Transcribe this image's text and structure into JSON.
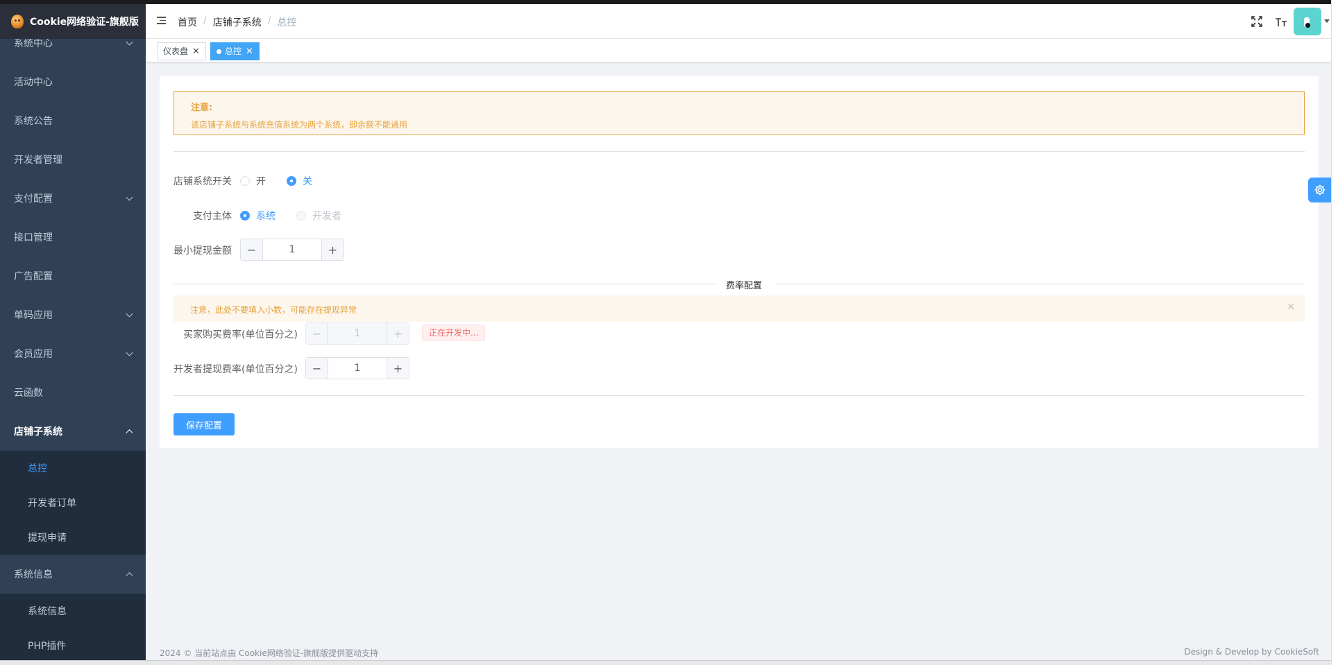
{
  "app": {
    "title": "Cookie网络验证-旗舰版"
  },
  "sidebar": {
    "items": [
      {
        "label": "系统中心",
        "has_children": true
      },
      {
        "label": "活动中心",
        "has_children": false
      },
      {
        "label": "系统公告",
        "has_children": false
      },
      {
        "label": "开发者管理",
        "has_children": false
      },
      {
        "label": "支付配置",
        "has_children": true
      },
      {
        "label": "接口管理",
        "has_children": false
      },
      {
        "label": "广告配置",
        "has_children": false
      },
      {
        "label": "单码应用",
        "has_children": true
      },
      {
        "label": "会员应用",
        "has_children": true
      },
      {
        "label": "云函数",
        "has_children": false
      },
      {
        "label": "店铺子系统",
        "has_children": true,
        "expanded": true
      },
      {
        "label": "系统信息",
        "has_children": true,
        "expanded": true
      }
    ],
    "shop_children": [
      "总控",
      "开发者订单",
      "提现申请"
    ],
    "info_children": [
      "系统信息",
      "PHP插件"
    ]
  },
  "header": {
    "breadcrumb": [
      "首页",
      "店铺子系统",
      "总控"
    ]
  },
  "tags": [
    {
      "label": "仪表盘",
      "active": false
    },
    {
      "label": "总控",
      "active": true
    }
  ],
  "notice": {
    "title": "注意:",
    "desc": "该店铺子系统与系统充值系统为两个系统，即余额不能通用"
  },
  "form": {
    "shop_switch": {
      "label": "店铺系统开关",
      "options": [
        "开",
        "关"
      ],
      "selected": "关"
    },
    "pay_subject": {
      "label": "支付主体",
      "options": [
        "系统",
        "开发者"
      ],
      "selected": "系统",
      "disabled_option": "开发者"
    },
    "min_withdraw": {
      "label": "最小提现金额",
      "value": "1"
    },
    "rate_divider": "费率配置",
    "rate_warning": "注意，此处不要填入小数，可能存在提现异常",
    "buyer_rate": {
      "label": "买家购买费率(单位百分之)",
      "value": "1",
      "disabled": true,
      "tag": "正在开发中..."
    },
    "dev_rate": {
      "label": "开发者提现费率(单位百分之)",
      "value": "1"
    },
    "save": "保存配置"
  },
  "footer": {
    "left": "2024 © 当前站点由 Cookie网络验证-旗舰版提供驱动支持",
    "right": "Design & Develop by CookieSoft"
  },
  "colors": {
    "primary": "#409eff",
    "sidebar": "#304156",
    "warning": "#e6a23c",
    "danger": "#f56c6c"
  }
}
